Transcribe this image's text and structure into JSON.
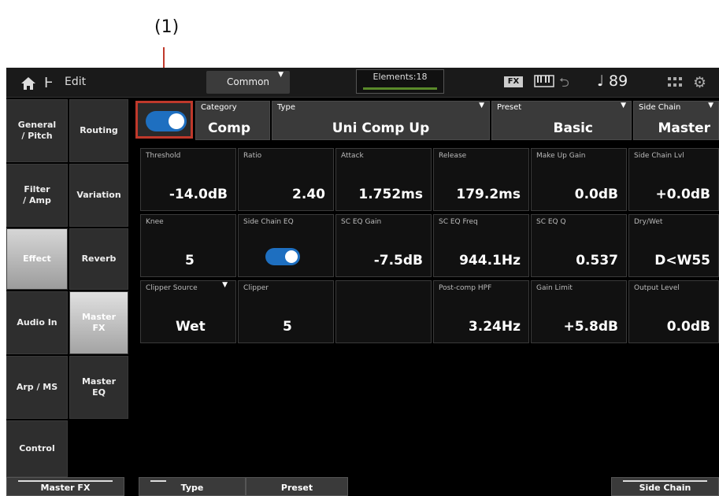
{
  "callout": "(1)",
  "topbar": {
    "edit_label": "Edit",
    "common_label": "Common",
    "elements_label": "Elements:18",
    "fx_badge": "FX",
    "tempo": "♩ 89"
  },
  "nav_col1": [
    {
      "label": "General\n/ Pitch"
    },
    {
      "label": "Filter\n/ Amp"
    },
    {
      "label": "Effect"
    },
    {
      "label": "Audio In"
    },
    {
      "label": "Arp / MS"
    },
    {
      "label": "Control"
    }
  ],
  "nav_col2": [
    {
      "label": "Routing"
    },
    {
      "label": "Variation"
    },
    {
      "label": "Reverb"
    },
    {
      "label": "Master\nFX"
    },
    {
      "label": "Master\nEQ"
    }
  ],
  "header": {
    "category": {
      "label": "Category",
      "value": "Comp"
    },
    "type": {
      "label": "Type",
      "value": "Uni Comp Up"
    },
    "preset": {
      "label": "Preset",
      "value": "Basic"
    },
    "side_chain": {
      "label": "Side Chain",
      "value": "Master"
    }
  },
  "params_row1": [
    {
      "label": "Threshold",
      "value": "-14.0dB"
    },
    {
      "label": "Ratio",
      "value": "2.40"
    },
    {
      "label": "Attack",
      "value": "1.752ms"
    },
    {
      "label": "Release",
      "value": "179.2ms"
    },
    {
      "label": "Make Up Gain",
      "value": "0.0dB"
    },
    {
      "label": "Side Chain Lvl",
      "value": "+0.0dB"
    }
  ],
  "params_row2": [
    {
      "label": "Knee",
      "value": "5"
    },
    {
      "label": "Side Chain EQ",
      "value": ""
    },
    {
      "label": "SC EQ Gain",
      "value": "-7.5dB"
    },
    {
      "label": "SC EQ Freq",
      "value": "944.1Hz"
    },
    {
      "label": "SC EQ Q",
      "value": "0.537"
    },
    {
      "label": "Dry/Wet",
      "value": "D<W55"
    }
  ],
  "params_row3": [
    {
      "label": "Clipper Source",
      "value": "Wet"
    },
    {
      "label": "Clipper",
      "value": "5"
    },
    {
      "label": "Post-comp HPF",
      "value": "3.24Hz"
    },
    {
      "label": "Gain Limit",
      "value": "+5.8dB"
    },
    {
      "label": "Output Level",
      "value": "0.0dB"
    }
  ],
  "bottom_tabs": {
    "master_fx": "Master FX",
    "type": "Type",
    "preset": "Preset",
    "side_chain": "Side Chain"
  },
  "colors": {
    "toggle_on": "#1e6fc0",
    "callout": "#c0392b"
  }
}
